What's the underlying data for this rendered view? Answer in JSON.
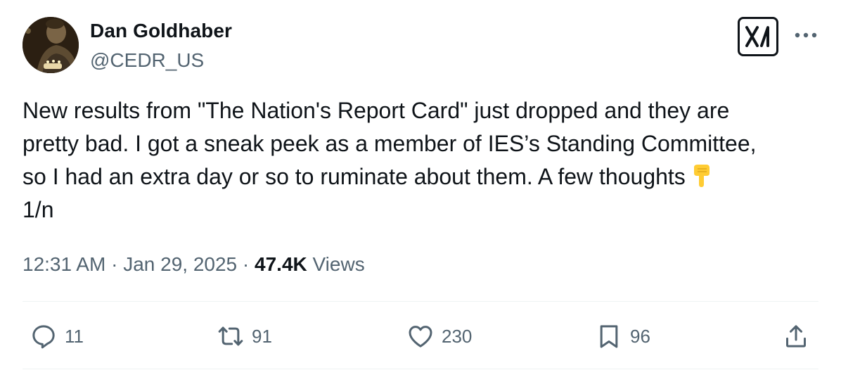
{
  "author": {
    "display_name": "Dan Goldhaber",
    "handle": "@CEDR_US"
  },
  "tweet": {
    "lines": [
      "New results from \"The Nation's Report Card\" just dropped and they are",
      "pretty bad. I got a sneak peek as a member of IES’s Standing Committee,",
      "so I had an extra day or so to ruminate about them. A few thoughts",
      "1/n"
    ],
    "emoji": "backhand-index-pointing-down"
  },
  "meta": {
    "time": "12:31 AM",
    "separator": "·",
    "date": "Jan 29, 2025",
    "views_count": "47.4K",
    "views_label": "Views"
  },
  "actions": {
    "replies": "11",
    "reposts": "91",
    "likes": "230",
    "bookmarks": "96"
  },
  "icons": [
    "x-logo-icon",
    "more-icon",
    "reply-icon",
    "repost-icon",
    "like-icon",
    "bookmark-icon",
    "share-icon"
  ],
  "colors": {
    "text_primary": "#0f1419",
    "text_secondary": "#536471",
    "divider": "#eff3f4",
    "background": "#ffffff"
  }
}
